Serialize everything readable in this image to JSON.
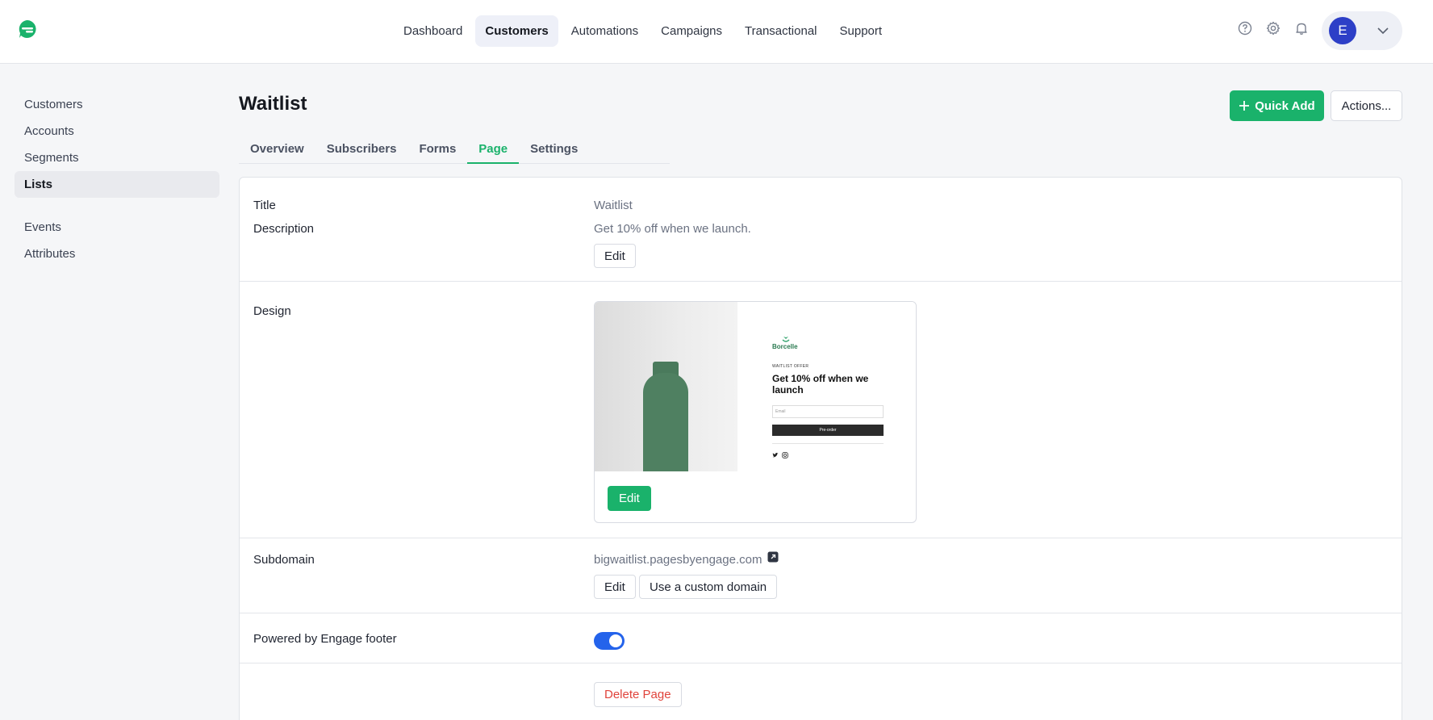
{
  "nav": {
    "items": [
      "Dashboard",
      "Customers",
      "Automations",
      "Campaigns",
      "Transactional",
      "Support"
    ],
    "active": "Customers"
  },
  "user": {
    "initial": "E"
  },
  "sidebar": {
    "items": [
      "Customers",
      "Accounts",
      "Segments",
      "Lists"
    ],
    "items2": [
      "Events",
      "Attributes"
    ],
    "active": "Lists"
  },
  "header": {
    "title": "Waitlist",
    "quick_add": "Quick Add",
    "actions": "Actions..."
  },
  "tabs": [
    "Overview",
    "Subscribers",
    "Forms",
    "Page",
    "Settings"
  ],
  "active_tab": "Page",
  "page": {
    "title_label": "Title",
    "title_value": "Waitlist",
    "description_label": "Description",
    "description_value": "Get 10% off when we launch.",
    "edit_label": "Edit",
    "design_label": "Design",
    "design_edit": "Edit",
    "preview": {
      "brand": "Borcelle",
      "eyebrow": "WAITLIST OFFER",
      "headline": "Get 10% off when we launch",
      "email_placeholder": "Email",
      "button": "Pre-order"
    },
    "subdomain_label": "Subdomain",
    "subdomain_value": "bigwaitlist.pagesbyengage.com",
    "subdomain_edit": "Edit",
    "custom_domain": "Use a custom domain",
    "footer_label": "Powered by Engage footer",
    "footer_enabled": true,
    "delete": "Delete Page"
  },
  "colors": {
    "accent": "#1ab26b",
    "toggle": "#2463eb",
    "danger": "#e0433b",
    "avatar": "#2d3fc7"
  }
}
